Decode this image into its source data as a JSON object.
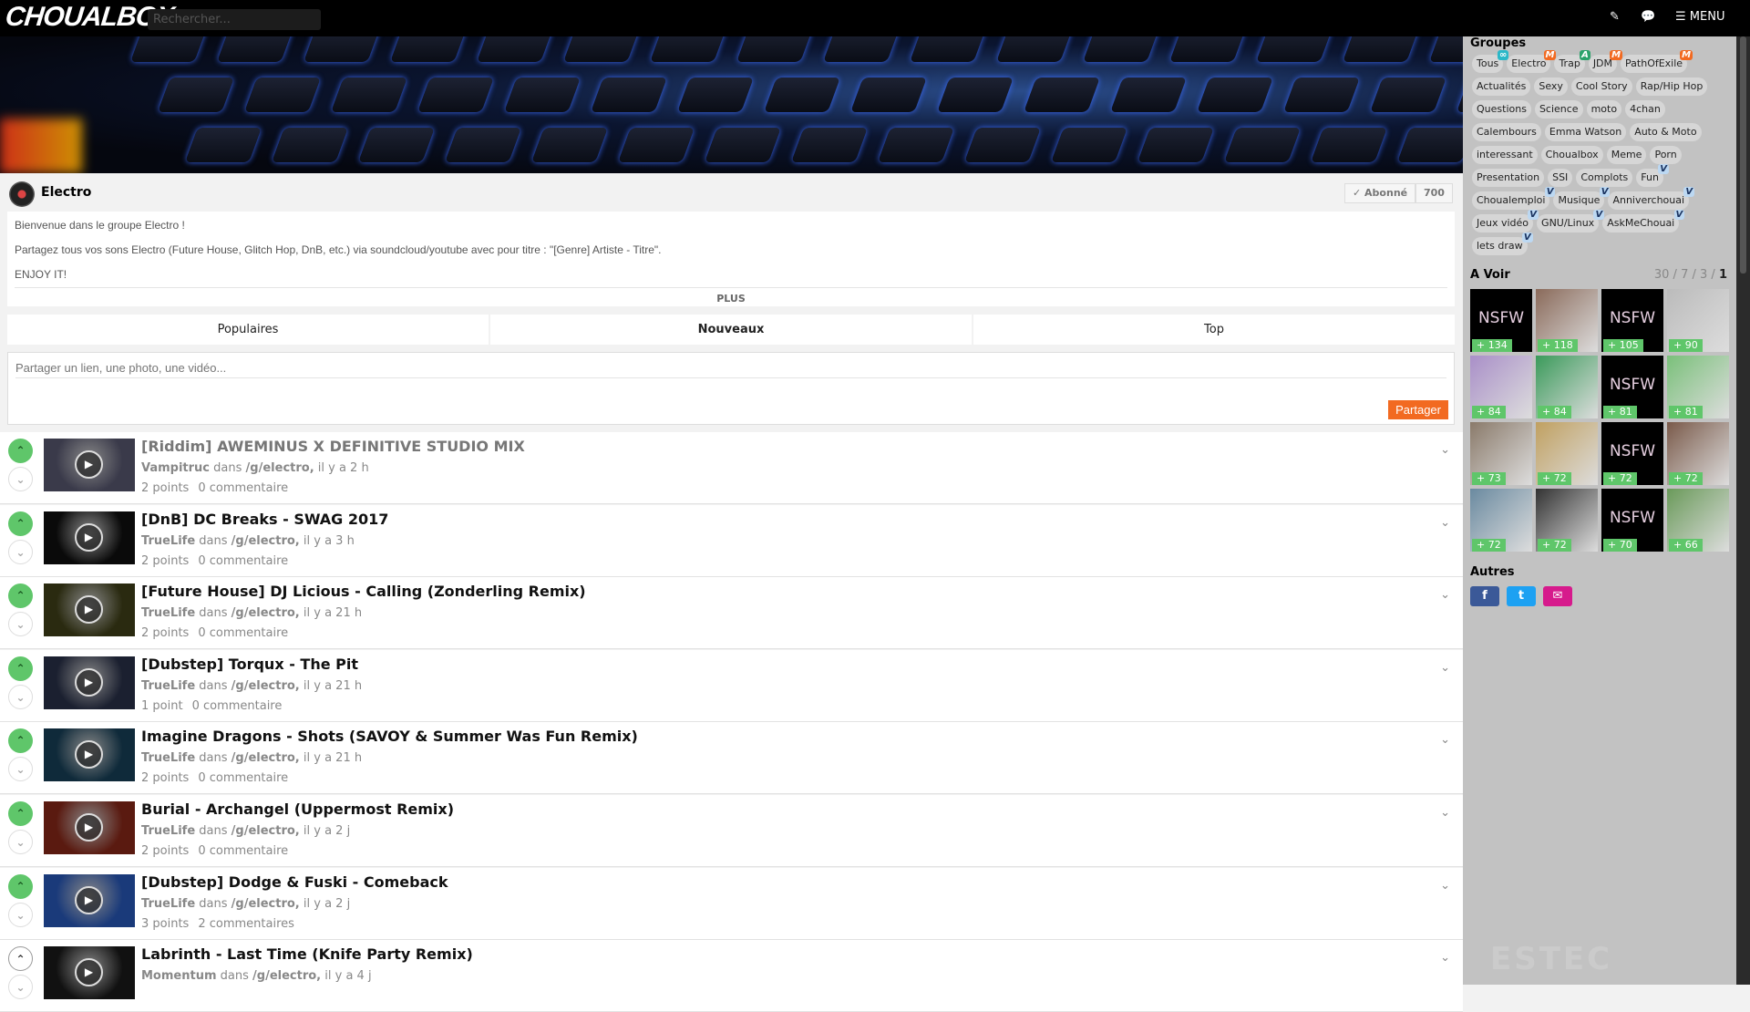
{
  "header": {
    "logo": "CHOUALBOX",
    "search_placeholder": "Rechercher...",
    "menu_label": "MENU",
    "icons": [
      "edit-icon",
      "chat-icon",
      "hamburger-icon"
    ]
  },
  "group": {
    "name": "Electro",
    "subscribe_label": "✓ Abonné",
    "subscriber_count": "700",
    "description": [
      "Bienvenue dans le groupe Electro !",
      "Partagez tous vos sons Electro (Future House, Glitch Hop, DnB, etc.) via soundcloud/youtube avec pour titre : \"[Genre] Artiste - Titre\".",
      "ENJOY IT!"
    ],
    "more_label": "PLUS"
  },
  "tabs": [
    {
      "label": "Populaires",
      "active": false
    },
    {
      "label": "Nouveaux",
      "active": true
    },
    {
      "label": "Top",
      "active": false
    }
  ],
  "share": {
    "placeholder": "Partager un lien, une photo, une vidéo...",
    "button": "Partager"
  },
  "posts": [
    {
      "title": "[Riddim] AWEMINUS X DEFINITIVE STUDIO MIX",
      "author": "Vampitruc",
      "dans": "dans",
      "group": "/g/electro,",
      "time": "il y a 2 h",
      "points": "2 points",
      "comments": "0 commentaire",
      "visited": true,
      "upvoted": true,
      "thumb": "#3a3a4a"
    },
    {
      "title": "[DnB] DC Breaks - SWAG 2017",
      "author": "TrueLife",
      "dans": "dans",
      "group": "/g/electro,",
      "time": "il y a 3 h",
      "points": "2 points",
      "comments": "0 commentaire",
      "upvoted": true,
      "thumb": "#0a0a0a"
    },
    {
      "title": "[Future House] DJ Licious - Calling (Zonderling Remix)",
      "author": "TrueLife",
      "dans": "dans",
      "group": "/g/electro,",
      "time": "il y a 21 h",
      "points": "2 points",
      "comments": "0 commentaire",
      "upvoted": true,
      "thumb": "#2a2a10"
    },
    {
      "title": "[Dubstep] Torqux - The Pit",
      "author": "TrueLife",
      "dans": "dans",
      "group": "/g/electro,",
      "time": "il y a 21 h",
      "points": "1 point",
      "comments": "0 commentaire",
      "upvoted": true,
      "thumb": "#1b2030"
    },
    {
      "title": "Imagine Dragons - Shots (SAVOY & Summer Was Fun Remix)",
      "author": "TrueLife",
      "dans": "dans",
      "group": "/g/electro,",
      "time": "il y a 21 h",
      "points": "2 points",
      "comments": "0 commentaire",
      "upvoted": true,
      "thumb": "#0f2a3a"
    },
    {
      "title": "Burial - Archangel (Uppermost Remix)",
      "author": "TrueLife",
      "dans": "dans",
      "group": "/g/electro,",
      "time": "il y a 2 j",
      "points": "2 points",
      "comments": "0 commentaire",
      "upvoted": true,
      "thumb": "#5a1a10"
    },
    {
      "title": "[Dubstep] Dodge & Fuski - Comeback",
      "author": "TrueLife",
      "dans": "dans",
      "group": "/g/electro,",
      "time": "il y a 2 j",
      "points": "3 points",
      "comments": "2 commentaires",
      "upvoted": true,
      "thumb": "#1a3a7a"
    },
    {
      "title": "Labrinth - Last Time (Knife Party Remix)",
      "author": "Momentum",
      "dans": "dans",
      "group": "/g/electro,",
      "time": "il y a 4 j",
      "points": "",
      "comments": "",
      "upvoted": false,
      "thumb": "#111"
    }
  ],
  "sidebar": {
    "groups_title": "Groupes",
    "groups": [
      {
        "label": "Tous",
        "badge": "∞"
      },
      {
        "label": "Electro",
        "badge": "M"
      },
      {
        "label": "Trap",
        "badge": "A"
      },
      {
        "label": "JDM",
        "badge": "M"
      },
      {
        "label": "PathOfExile",
        "badge": "M"
      },
      {
        "label": "Actualités"
      },
      {
        "label": "Sexy"
      },
      {
        "label": "Cool Story"
      },
      {
        "label": "Rap/Hip Hop"
      },
      {
        "label": "Questions"
      },
      {
        "label": "Science"
      },
      {
        "label": "moto"
      },
      {
        "label": "4chan"
      },
      {
        "label": "Calembours"
      },
      {
        "label": "Emma Watson"
      },
      {
        "label": "Auto & Moto"
      },
      {
        "label": "interessant"
      },
      {
        "label": "Choualbox"
      },
      {
        "label": "Meme"
      },
      {
        "label": "Porn"
      },
      {
        "label": "Presentation"
      },
      {
        "label": "SSI"
      },
      {
        "label": "Complots"
      },
      {
        "label": "Fun",
        "badge": "V"
      },
      {
        "label": "Choualemploi",
        "badge": "V"
      },
      {
        "label": "Musique",
        "badge": "V"
      },
      {
        "label": "Anniverchouai",
        "badge": "V"
      },
      {
        "label": "Jeux vidéo",
        "badge": "V"
      },
      {
        "label": "GNU/Linux",
        "badge": "V"
      },
      {
        "label": "AskMeChouai",
        "badge": "V"
      },
      {
        "label": "lets draw",
        "badge": "V"
      }
    ],
    "avoir_title": "A Voir",
    "avoir_filters": [
      "30",
      "7",
      "3",
      "1"
    ],
    "avoir": [
      {
        "nsfw": true,
        "points": "+ 134"
      },
      {
        "points": "+ 118",
        "c": "#8a6a5a"
      },
      {
        "nsfw": true,
        "points": "+ 105"
      },
      {
        "points": "+ 90",
        "c": "#bbb"
      },
      {
        "points": "+ 84",
        "c": "#a98fc8"
      },
      {
        "points": "+ 84",
        "c": "#3a9a5a"
      },
      {
        "nsfw": true,
        "points": "+ 81"
      },
      {
        "points": "+ 81",
        "c": "#7ac07a"
      },
      {
        "points": "+ 73",
        "c": "#8a7a6a"
      },
      {
        "points": "+ 72",
        "c": "#c0a060"
      },
      {
        "nsfw": true,
        "points": "+ 72"
      },
      {
        "points": "+ 72",
        "c": "#7a5a4a"
      },
      {
        "points": "+ 72",
        "c": "#6a8aa0"
      },
      {
        "points": "+ 72",
        "c": "#333"
      },
      {
        "nsfw": true,
        "points": "+ 70"
      },
      {
        "points": "+ 66",
        "c": "#6a9a5a"
      }
    ],
    "nsfw_label": "NSFW",
    "autres_title": "Autres",
    "social": [
      {
        "icon": "facebook-icon",
        "glyph": "f",
        "color": "#3b5998"
      },
      {
        "icon": "twitter-icon",
        "glyph": "t",
        "color": "#1da1f2"
      },
      {
        "icon": "mail-icon",
        "glyph": "✉",
        "color": "#d61a8c"
      }
    ],
    "watermark": "ESTEC"
  }
}
